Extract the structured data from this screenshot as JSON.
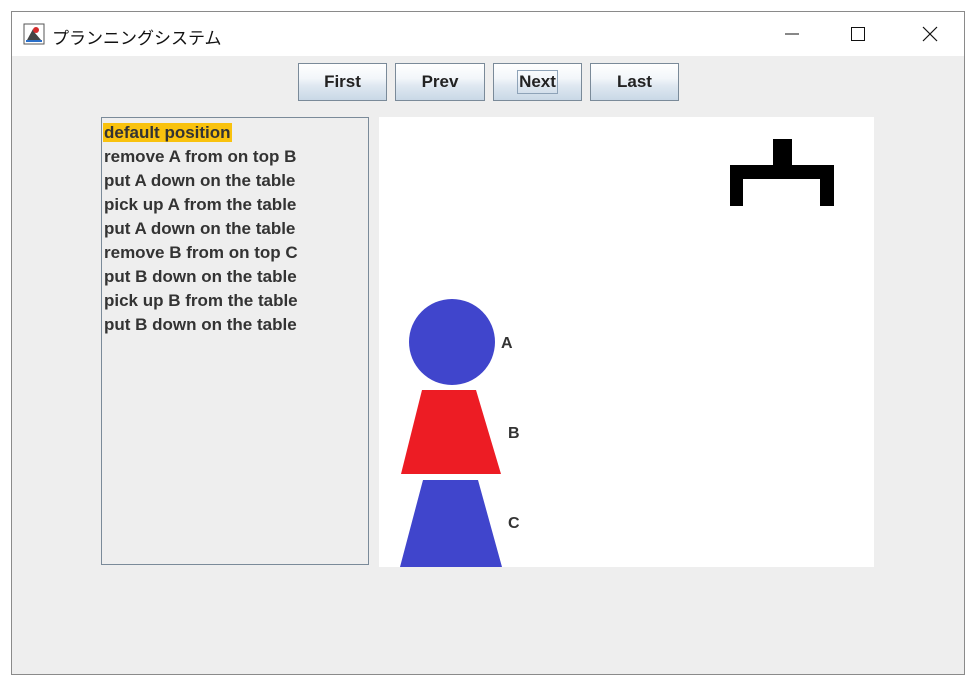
{
  "window": {
    "title": "プランニングシステム",
    "icon": "java-app-icon"
  },
  "titlebar_controls": [
    "minimize-icon",
    "maximize-icon",
    "close-icon"
  ],
  "nav_buttons": {
    "first": "First",
    "prev": "Prev",
    "next": "Next",
    "last": "Last"
  },
  "steps": [
    "default position",
    "remove A from on top B",
    "put A down on the table",
    "pick up A from the table",
    "put A down on the table",
    "remove B from on top C",
    "put B down on the table",
    "pick up B from the table",
    "put B down on the table"
  ],
  "selected_step_index": 0,
  "scene": {
    "blocks": [
      {
        "label": "A",
        "shape": "circle",
        "color": "#4045cc"
      },
      {
        "label": "B",
        "shape": "trapezoid",
        "color": "#ed1c24"
      },
      {
        "label": "C",
        "shape": "trapezoid",
        "color": "#4045cc"
      }
    ],
    "gripper": {
      "color": "#000000"
    }
  },
  "colors": {
    "selection": "#f9c20e",
    "window_bg": "#eeeeee"
  }
}
